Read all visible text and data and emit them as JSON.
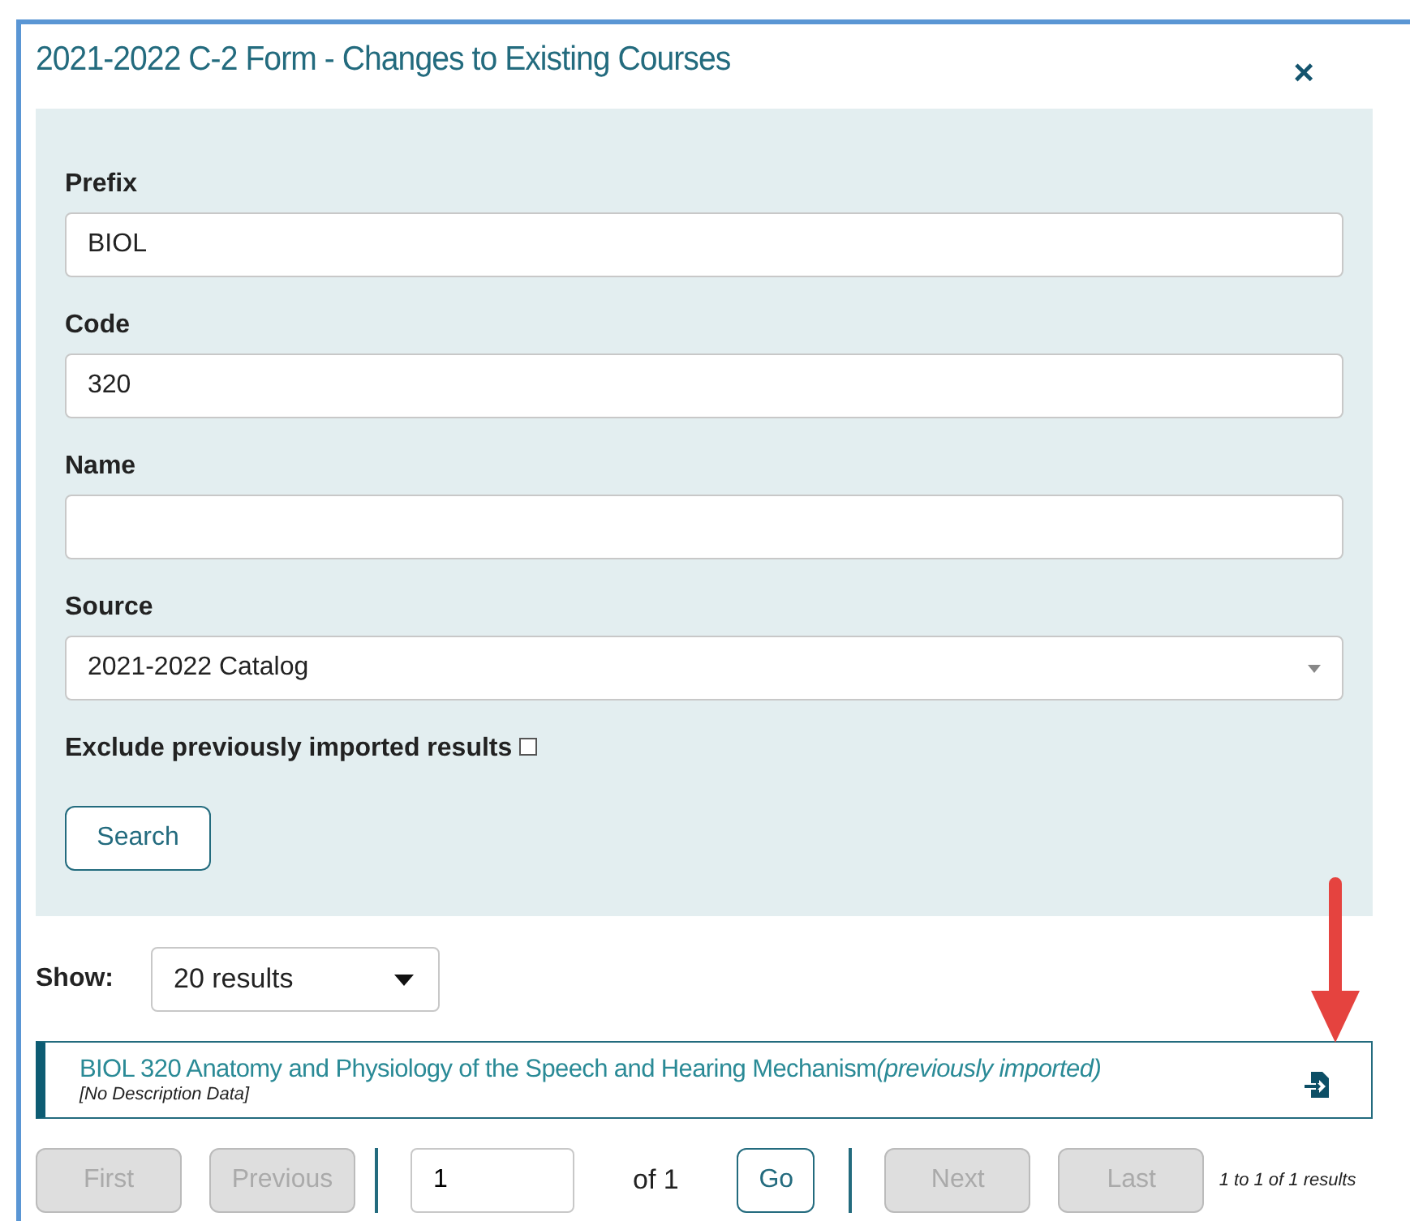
{
  "dialog": {
    "title": "2021-2022 C-2 Form - Changes to Existing Courses",
    "close": "×"
  },
  "search_form": {
    "fields": [
      {
        "kind": "input",
        "label": "Prefix",
        "value": "BIOL"
      },
      {
        "kind": "input",
        "label": "Code",
        "value": "320"
      },
      {
        "kind": "input",
        "label": "Name"
      },
      {
        "kind": "select",
        "label": "Source",
        "value": "2021-2022 Catalog"
      }
    ],
    "exclude": {
      "label": "Exclude previously imported results",
      "checked": false
    },
    "search_button": "Search"
  },
  "show": {
    "label": "Show:",
    "value": "20 results"
  },
  "results": [
    {
      "title": "BIOL 320 Anatomy and Physiology of the Speech and Hearing Mechanism",
      "note": "(previously imported)",
      "description": "[No Description Data]"
    }
  ],
  "pagination": {
    "first": {
      "label": "First",
      "disabled": true
    },
    "previous": {
      "label": "Previous",
      "disabled": true
    },
    "page": "1",
    "of": "of 1",
    "go": "Go",
    "next": {
      "label": "Next",
      "disabled": true
    },
    "last": {
      "label": "Last",
      "disabled": true
    },
    "summary": "1 to 1 of 1 results"
  }
}
